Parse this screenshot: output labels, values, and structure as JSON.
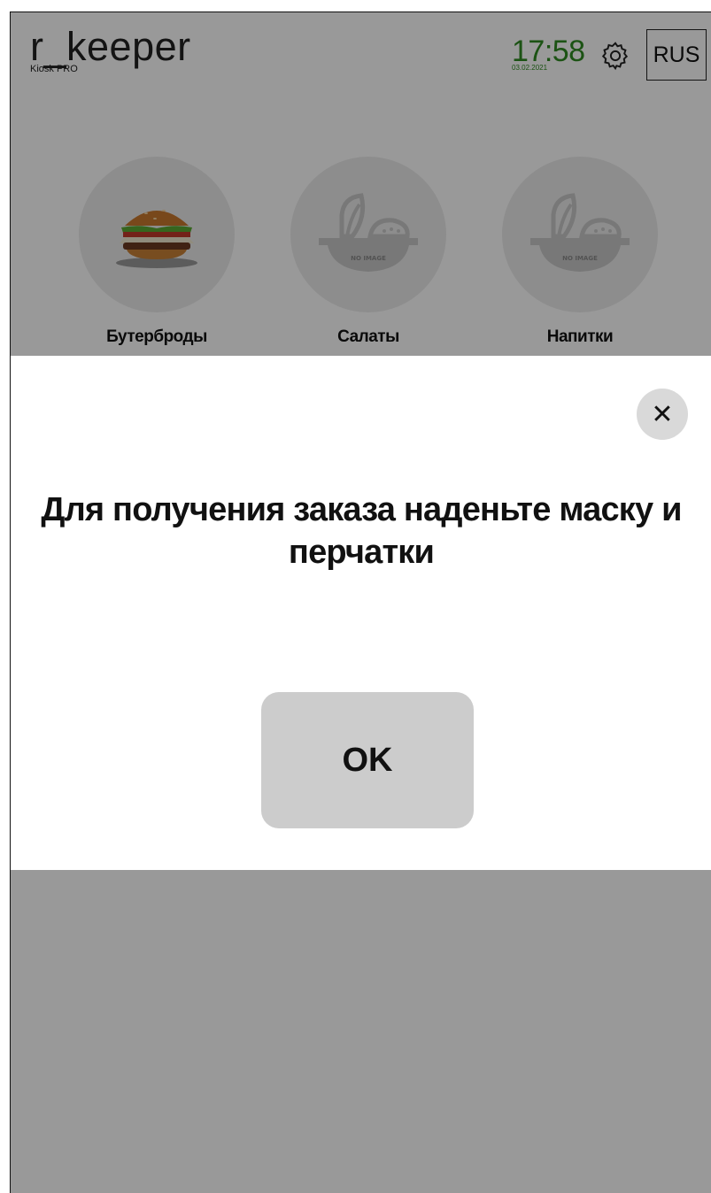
{
  "header": {
    "brand_title": "r_keeper",
    "brand_subtitle": "Kiosk PRO",
    "time": "17:58",
    "date": "03.02.2021",
    "settings_icon": "gear-icon",
    "language_label": "RUS"
  },
  "categories": [
    {
      "label": "Бутерброды",
      "image": "burger-image"
    },
    {
      "label": "Салаты",
      "image": "no-image-placeholder"
    },
    {
      "label": "Напитки",
      "image": "no-image-placeholder"
    }
  ],
  "placeholder_text": "NO IMAGE",
  "modal": {
    "close_icon": "close-icon",
    "close_symbol": "✕",
    "message": "Для получения заказа наденьте маску и перчатки",
    "ok_label": "OK"
  },
  "colors": {
    "accent_time": "#2f8a22",
    "overlay": "rgba(0,0,0,0.4)",
    "button_bg": "#cccccc"
  }
}
